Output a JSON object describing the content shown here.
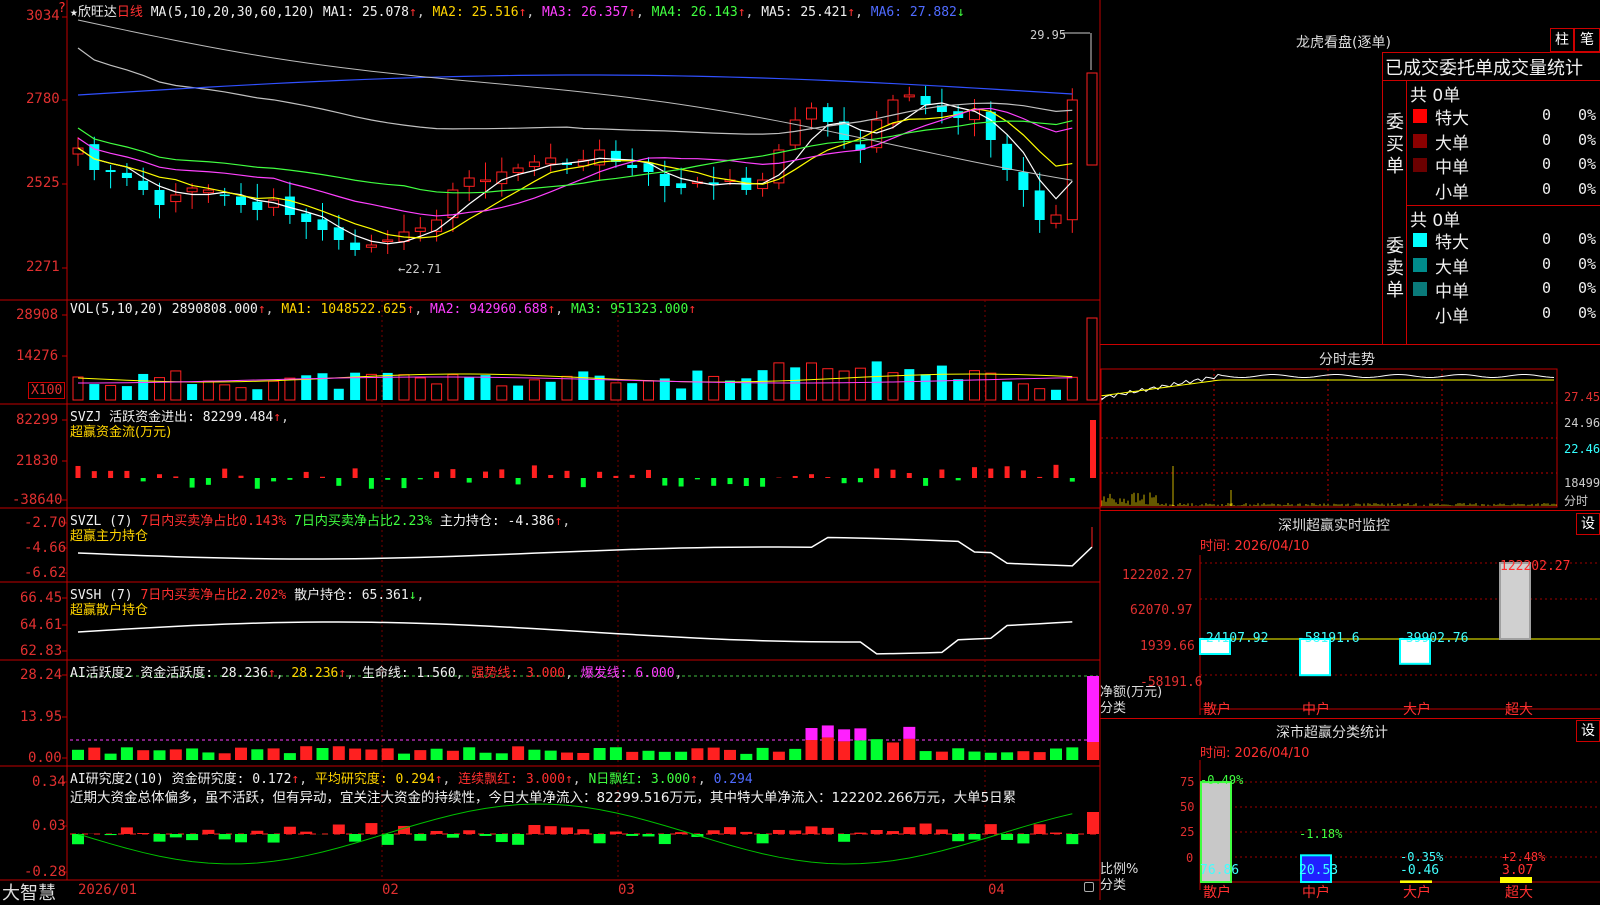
{
  "app": {
    "brand_label": "大智慧",
    "stock_name": "欣旺达",
    "period": "日线",
    "star": "★",
    "red_mark": "?"
  },
  "main_chart": {
    "ma_label": "MA(5,10,20,30,60,120)",
    "ma1": "MA1: 25.078",
    "ma2": "MA2: 25.516",
    "ma3": "MA3: 26.357",
    "ma4": "MA4: 26.143",
    "ma5": "MA5: 25.421",
    "ma6": "MA6: 27.882",
    "high_note": "29.95",
    "low_note": "←22.71",
    "y_axis": [
      "3034",
      "2780",
      "2525",
      "2271"
    ],
    "colors": {
      "ma1": "#ffffff",
      "ma2": "#ffff00",
      "ma3": "#ff40ff",
      "ma4": "#40ff40",
      "ma5": "#c0c0c0",
      "ma6": "#3050ff"
    }
  },
  "volume": {
    "label": "VOL(5,10,20)",
    "value": "2890808.000",
    "ma1": "MA1: 1048522.625",
    "ma2": "MA2: 942960.688",
    "ma3": "MA3: 951323.000",
    "y_axis": [
      "28908",
      "14276"
    ],
    "unit": "X100"
  },
  "svzj": {
    "title": "SVZJ  活跃资金进出: 82299.484",
    "subtitle": "超赢资金流(万元)",
    "y_axis": [
      "82299",
      "21830",
      "-38640"
    ]
  },
  "svzl": {
    "title": "SVZL  (7)",
    "t1": "7日内买卖净占比0.143%",
    "t2": "7日内买卖净占比2.23%",
    "t3": "主力持仓: -4.386",
    "subtitle": "超赢主力持仓",
    "y_axis": [
      "-2.70",
      "-4.66",
      "-6.62"
    ]
  },
  "svsh": {
    "title": "SVSH  (7)",
    "t1": "7日内买卖净占比2.202%",
    "t2": "散户持仓: 65.361",
    "subtitle": "超赢散户持仓",
    "y_axis": [
      "66.45",
      "64.61",
      "62.83"
    ]
  },
  "ai_active": {
    "title": "AI活跃度2 资金活跃度: 28.236",
    "v2": "28.236",
    "v3": "生命线: 1.560",
    "v4": "强势线: 3.000",
    "v5": "爆发线: 6.000",
    "y_axis": [
      "28.24",
      "13.95",
      "0.00"
    ]
  },
  "ai_research": {
    "title": "AI研究度2(10) 资金研究度: 0.172",
    "t1": "平均研究度: 0.294",
    "t2": "连续飘红: 3.000",
    "t3": "N日飘红: 3.000",
    "t4": "0.294",
    "comment": "近期大资金总体偏多，虽不活跃，但有异动，宜关注大资金的持续性，今日大单净流入：82299.516万元，其中特大单净流入：122202.266万元，大单5日累",
    "y_axis": [
      "0.34",
      "0.03",
      "-0.28"
    ]
  },
  "dates": {
    "d1": "2026/01",
    "d2": "02",
    "d3": "03",
    "d4": "04"
  },
  "right": {
    "lhb_title": "龙虎看盘(逐单)",
    "btn_bar": "柱",
    "btn_pen": "笔",
    "stats_title": "已成交委托单成交量统计",
    "buy_label": "委买单",
    "sell_label": "委卖单",
    "buy_total": "共 0单",
    "sell_total": "共 0单",
    "rows": [
      {
        "name": "特大",
        "v": "0",
        "p": "0%"
      },
      {
        "name": "大单",
        "v": "0",
        "p": "0%"
      },
      {
        "name": "中单",
        "v": "0",
        "p": "0%"
      },
      {
        "name": "小单",
        "v": "0",
        "p": "0%"
      }
    ],
    "buy_colors": [
      "#ff0000",
      "#8b0000",
      "#6b0000",
      "#000000"
    ],
    "sell_colors": [
      "#00ffff",
      "#008b8b",
      "#0a7a7a",
      "#000000"
    ],
    "intraday_title": "分时走势",
    "intraday_axis": [
      "27.45",
      "24.96",
      "22.46",
      "18499",
      "分时"
    ],
    "monitor_title": "深圳超赢实时监控",
    "monitor_btn": "设",
    "monitor_time": "时间: 2026/04/10",
    "monitor_axis": [
      "122202.27",
      "62070.97",
      "1939.66",
      "-58191.6"
    ],
    "monitor_unit": "净额(万元)",
    "monitor_cat": "分类",
    "monitor_vals": [
      {
        "label": "-24107.92",
        "value": -24107.92,
        "cat": "散户"
      },
      {
        "label": "-58191.6",
        "value": -58191.6,
        "cat": "中户"
      },
      {
        "label": "-39902.76",
        "value": -39902.76,
        "cat": "大户"
      },
      {
        "label": "122202.27",
        "value": 122202.27,
        "cat": "超大"
      }
    ],
    "class_title": "深市超赢分类统计",
    "class_btn": "设",
    "class_time": "时间: 2026/04/10",
    "class_axis": [
      "75",
      "50",
      "25",
      "0"
    ],
    "class_unit": "比例%",
    "class_cat": "分类",
    "class_vals": [
      {
        "top": "-0.49%",
        "bottom": "76.86",
        "value": 76.86,
        "cat": "散户"
      },
      {
        "top": "-1.18%",
        "bottom": "20.53",
        "value": 20.53,
        "cat": "中户"
      },
      {
        "top": "-0.35%",
        "bottom": "-0.46",
        "value": 0.46,
        "cat": "大户"
      },
      {
        "top": "+2.48%",
        "bottom": "3.07",
        "value": 3.07,
        "cat": "超大"
      }
    ]
  }
}
